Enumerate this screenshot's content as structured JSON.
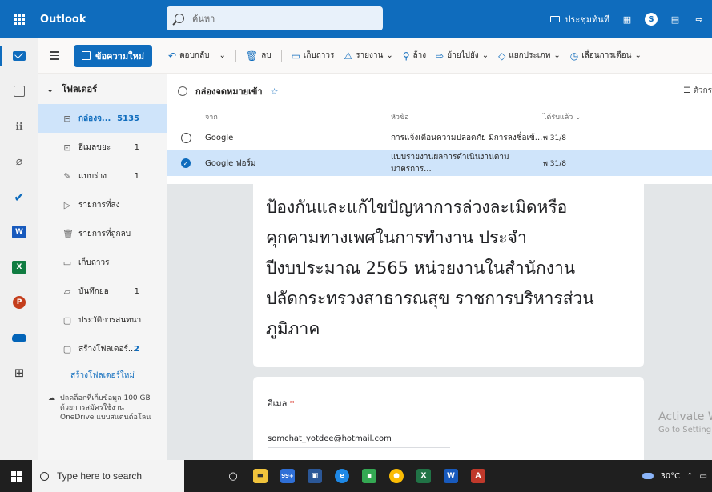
{
  "app": {
    "title": "Outlook"
  },
  "search": {
    "placeholder": "ค้นหา"
  },
  "topbar": {
    "meet_now": "ประชุมทันที"
  },
  "toolbar": {
    "new_mail": "ข้อความใหม่",
    "reply": "ตอบกลับ",
    "delete": "ลบ",
    "archive": "เก็บถาวร",
    "report": "รายงาน",
    "sweep": "ล้าง",
    "move_to": "ย้ายไปยัง",
    "categorize": "แยกประเภท",
    "snooze": "เลื่อนการเตือน"
  },
  "folders": {
    "header": "โฟลเดอร์",
    "items": [
      {
        "label": "กล่องจ...",
        "count": "5135",
        "icon": "inbox-icon"
      },
      {
        "label": "อีเมลขยะ",
        "count": "1",
        "icon": "junk-icon"
      },
      {
        "label": "แบบร่าง",
        "count": "1",
        "icon": "drafts-icon"
      },
      {
        "label": "รายการที่ส่ง",
        "count": "",
        "icon": "sent-icon"
      },
      {
        "label": "รายการที่ถูกลบ",
        "count": "",
        "icon": "trash-icon"
      },
      {
        "label": "เก็บถาวร",
        "count": "",
        "icon": "archive-icon"
      },
      {
        "label": "บันทึกย่อ",
        "count": "1",
        "icon": "notes-icon"
      },
      {
        "label": "ประวัติการสนทนา",
        "count": "",
        "icon": "folder-icon"
      },
      {
        "label": "สร้างโฟลเดอร์...",
        "count": "2",
        "icon": "folder-icon"
      }
    ],
    "new_folder": "สร้างโฟลเดอร์ใหม่",
    "promo": "ปลดล็อกที่เก็บข้อมูล 100 GB ด้วยการสมัครใช้งาน OneDrive แบบสแตนด์อโลน"
  },
  "message_list": {
    "title": "กล่องจดหมายเข้า",
    "filter": "ตัวกร",
    "columns": {
      "from": "จาก",
      "subject": "หัวข้อ",
      "received": "ได้รับแล้ว"
    },
    "rows": [
      {
        "from": "Google",
        "subject": "การแจ้งเตือนความปลอดภัย  มีการลงชื่อเข้...",
        "date": "พ 31/8",
        "selected": false
      },
      {
        "from": "Google ฟอร์ม",
        "subject": "แบบรายงานผลการดำเนินงานตามมาตรการ...",
        "date": "พ 31/8",
        "selected": true
      }
    ]
  },
  "reading_pane": {
    "form_title_lines": [
      "ป้องกันและแก้ไขปัญหาการล่วงละเมิดหรือ",
      "คุกคามทางเพศในการทำงาน ประจำ",
      "ปีงบประมาณ 2565 หน่วยงานในสำนักงาน",
      "ปลัดกระทรวงสาธารณสุข  ราชการบริหารส่วน",
      "ภูมิภาค"
    ],
    "email_label": "อีเมล",
    "required_mark": "*",
    "email_value": "somchat_yotdee@hotmail.com",
    "watermark_line1": "Activate W",
    "watermark_line2": "Go to Setting"
  },
  "taskbar": {
    "search_placeholder": "Type here to search",
    "badge": "99+",
    "temperature": "30°C"
  },
  "colors": {
    "accent": "#0f6cbd",
    "selected": "#cfe4fa"
  }
}
